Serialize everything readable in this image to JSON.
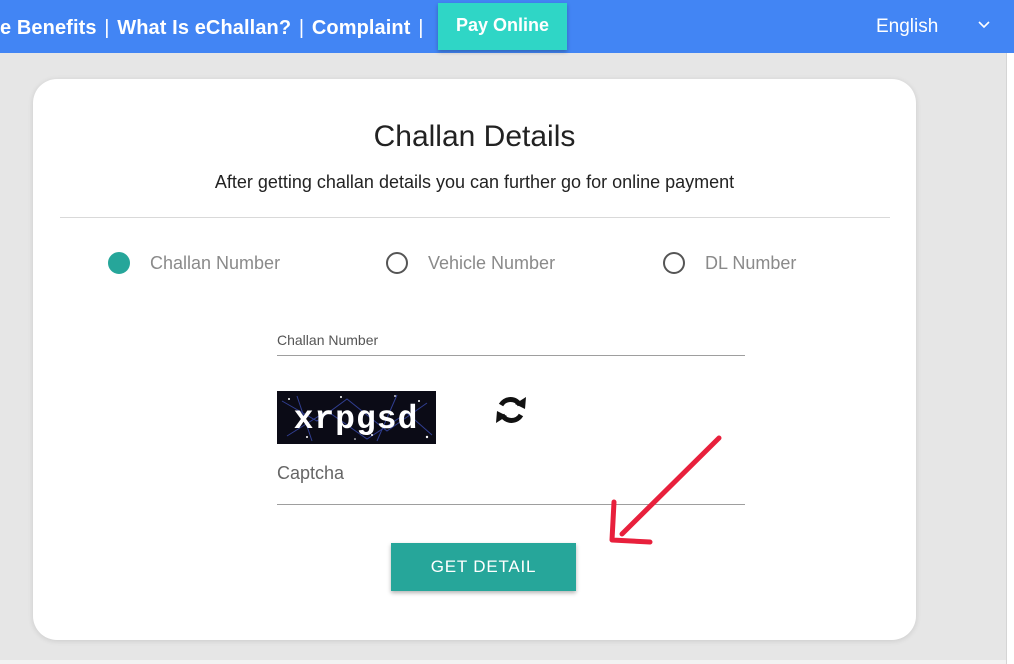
{
  "nav": {
    "links": [
      "e Benefits",
      "What Is eChallan?",
      "Complaint"
    ],
    "separator": "|",
    "pay_button": "Pay Online",
    "language": "English"
  },
  "card": {
    "title": "Challan Details",
    "subtitle": "After getting challan details you can further go for online payment",
    "radio_options": [
      {
        "label": "Challan Number",
        "selected": true
      },
      {
        "label": "Vehicle Number",
        "selected": false
      },
      {
        "label": "DL Number",
        "selected": false
      }
    ],
    "challan_field": {
      "placeholder": "Challan Number",
      "value": ""
    },
    "captcha_image_text": "xrpgsd",
    "captcha_field": {
      "placeholder": "Captcha",
      "value": ""
    },
    "submit_button": "GET DETAIL"
  },
  "colors": {
    "topbar": "#4285f4",
    "pay_button": "#2fd6c6",
    "accent": "#26a69a",
    "annotation_arrow": "#e8203c"
  },
  "icons": [
    "chevron-down-icon",
    "refresh-icon",
    "annotation-arrow"
  ]
}
